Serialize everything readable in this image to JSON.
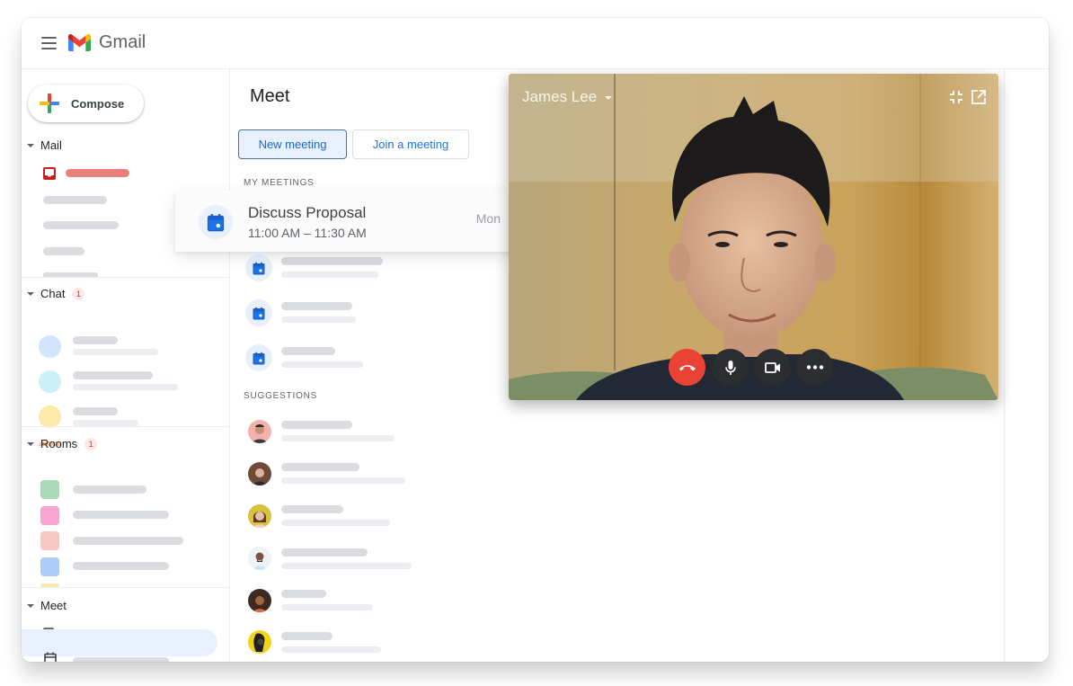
{
  "app": {
    "title": "Gmail",
    "menu_icon": "hamburger-menu-icon",
    "logo_icon": "gmail-m-logo"
  },
  "sidebar": {
    "compose_label": "Compose",
    "sections": {
      "mail": {
        "label": "Mail"
      },
      "chat": {
        "label": "Chat",
        "badge": "1"
      },
      "rooms": {
        "label": "Rooms",
        "badge": "1"
      },
      "meet": {
        "label": "Meet"
      }
    },
    "room_colors": [
      "#a8dab5",
      "#fba4d4",
      "#f8c6c3",
      "#aecbfa"
    ],
    "chat_colors": [
      "#d2e3fc",
      "#cbf0f8",
      "#fde9a8"
    ]
  },
  "meet": {
    "title": "Meet",
    "new_meeting_label": "New meeting",
    "join_meeting_label": "Join a meeting",
    "my_meetings_label": "MY MEETINGS",
    "suggestions_label": "SUGGESTIONS",
    "highlighted_meeting": {
      "title": "Discuss Proposal",
      "time": "11:00 AM – 11:30 AM",
      "day": "Mon"
    }
  },
  "video_call": {
    "caller_name": "James Lee",
    "controls": [
      "end-call",
      "microphone",
      "camera",
      "more-options"
    ],
    "end_call_color": "#ea4335"
  },
  "colors": {
    "accent": "#1a73e8",
    "active_nav": "#e8f0fe",
    "mail_red": "#c5221f"
  }
}
